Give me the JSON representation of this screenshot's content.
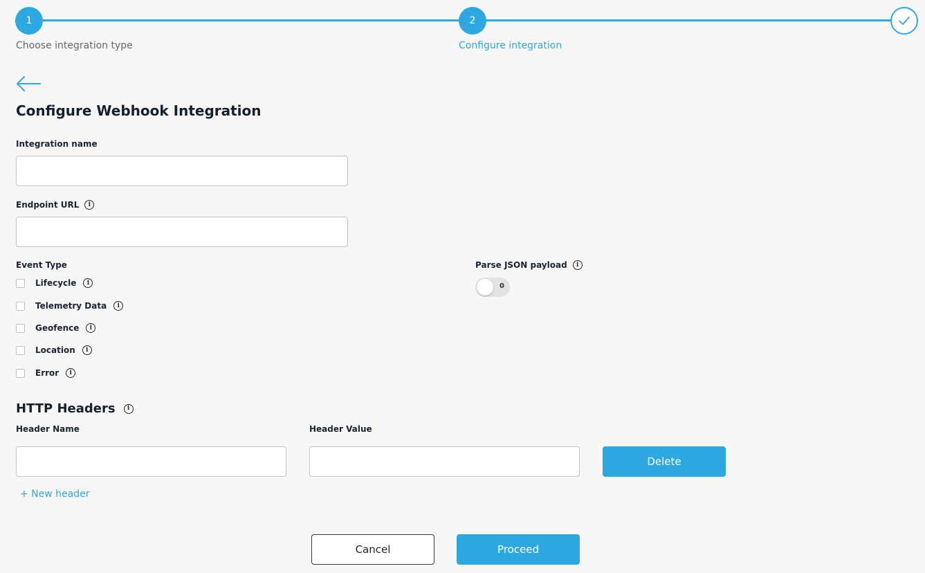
{
  "stepper": {
    "steps": [
      {
        "number": "1",
        "label": "Choose integration type"
      },
      {
        "number": "2",
        "label": "Configure integration"
      },
      {
        "number": "",
        "label": ""
      }
    ]
  },
  "icons": {
    "back": "arrow-left-icon",
    "complete": "check-icon",
    "info": "info-icon"
  },
  "colors": {
    "accent": "#2ea8e0",
    "background": "#f7f7f7",
    "text": "#1a2433"
  },
  "page": {
    "title": "Configure Webhook Integration"
  },
  "form": {
    "integration_name": {
      "label": "Integration name",
      "value": "",
      "placeholder": ""
    },
    "endpoint_url": {
      "label": "Endpoint URL",
      "value": "",
      "placeholder": ""
    },
    "event_type": {
      "label": "Event Type",
      "options": [
        {
          "label": "Lifecycle",
          "checked": false
        },
        {
          "label": "Telemetry Data",
          "checked": false
        },
        {
          "label": "Geofence",
          "checked": false
        },
        {
          "label": "Location",
          "checked": false
        },
        {
          "label": "Error",
          "checked": false
        }
      ]
    },
    "parse_json": {
      "label": "Parse JSON payload",
      "state_text": "0"
    }
  },
  "http_headers": {
    "title": "HTTP Headers",
    "name_label": "Header Name",
    "value_label": "Header Value",
    "delete_label": "Delete",
    "new_header_label": "+ New header"
  },
  "footer": {
    "cancel_label": "Cancel",
    "proceed_label": "Proceed"
  }
}
